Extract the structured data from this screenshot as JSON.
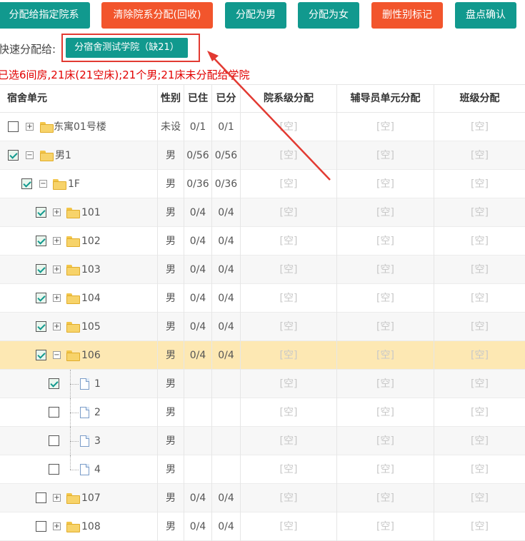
{
  "toolbar": {
    "assign_college": "分配给指定院系",
    "clear_assign": "清除院系分配(回收)",
    "assign_male": "分配为男",
    "assign_female": "分配为女",
    "delete_gender": "删性别标记",
    "inventory_confirm": "盘点确认"
  },
  "quick": {
    "label": "快速分配给:",
    "button": "分宿舍测试学院（缺21）"
  },
  "summary": "已选6间房,21床(21空床);21个男;21床未分配给学院",
  "columns": {
    "unit": "宿舍单元",
    "gender": "性别",
    "occupied": "已住",
    "assigned": "已分",
    "dept": "院系级分配",
    "counselor": "辅导员单元分配",
    "class": "班级分配"
  },
  "rows": [
    {
      "label": "东寓01号楼",
      "gender": "未设",
      "occupied": "0/1",
      "assigned": "0/1",
      "dept": "[空]",
      "counselor": "[空]",
      "class": "[空]"
    },
    {
      "label": "男1",
      "gender": "男",
      "occupied": "0/56",
      "assigned": "0/56",
      "dept": "[空]",
      "counselor": "[空]",
      "class": "[空]"
    },
    {
      "label": "1F",
      "gender": "男",
      "occupied": "0/36",
      "assigned": "0/36",
      "dept": "[空]",
      "counselor": "[空]",
      "class": "[空]"
    },
    {
      "label": "101",
      "gender": "男",
      "occupied": "0/4",
      "assigned": "0/4",
      "dept": "[空]",
      "counselor": "[空]",
      "class": "[空]"
    },
    {
      "label": "102",
      "gender": "男",
      "occupied": "0/4",
      "assigned": "0/4",
      "dept": "[空]",
      "counselor": "[空]",
      "class": "[空]"
    },
    {
      "label": "103",
      "gender": "男",
      "occupied": "0/4",
      "assigned": "0/4",
      "dept": "[空]",
      "counselor": "[空]",
      "class": "[空]"
    },
    {
      "label": "104",
      "gender": "男",
      "occupied": "0/4",
      "assigned": "0/4",
      "dept": "[空]",
      "counselor": "[空]",
      "class": "[空]"
    },
    {
      "label": "105",
      "gender": "男",
      "occupied": "0/4",
      "assigned": "0/4",
      "dept": "[空]",
      "counselor": "[空]",
      "class": "[空]"
    },
    {
      "label": "106",
      "gender": "男",
      "occupied": "0/4",
      "assigned": "0/4",
      "dept": "[空]",
      "counselor": "[空]",
      "class": "[空]"
    },
    {
      "label": "1",
      "gender": "男",
      "occupied": "",
      "assigned": "",
      "dept": "[空]",
      "counselor": "[空]",
      "class": "[空]"
    },
    {
      "label": "2",
      "gender": "男",
      "occupied": "",
      "assigned": "",
      "dept": "[空]",
      "counselor": "[空]",
      "class": "[空]"
    },
    {
      "label": "3",
      "gender": "男",
      "occupied": "",
      "assigned": "",
      "dept": "[空]",
      "counselor": "[空]",
      "class": "[空]"
    },
    {
      "label": "4",
      "gender": "男",
      "occupied": "",
      "assigned": "",
      "dept": "[空]",
      "counselor": "[空]",
      "class": "[空]"
    },
    {
      "label": "107",
      "gender": "男",
      "occupied": "0/4",
      "assigned": "0/4",
      "dept": "[空]",
      "counselor": "[空]",
      "class": "[空]"
    },
    {
      "label": "108",
      "gender": "男",
      "occupied": "0/4",
      "assigned": "0/4",
      "dept": "[空]",
      "counselor": "[空]",
      "class": "[空]"
    }
  ]
}
